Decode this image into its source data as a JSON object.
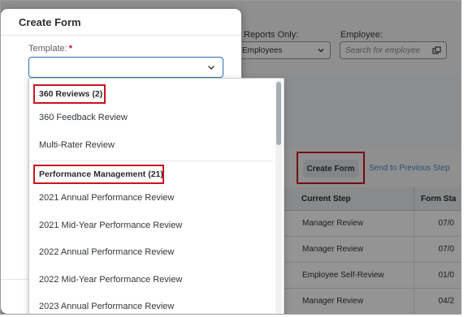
{
  "dialog": {
    "title": "Create Form",
    "template_label": "Template:",
    "required_marker": "*",
    "template_value": ""
  },
  "dropdown": {
    "groups": [
      {
        "label": "360 Reviews (2)",
        "items": [
          "360 Feedback Review",
          "Multi-Rater Review"
        ]
      },
      {
        "label": "Performance Management (21)",
        "items": [
          "2021 Annual Performance Review",
          "2021 Mid-Year Performance Review",
          "2022 Annual Performance Review",
          "2022 Mid-Year Performance Review",
          "2023 Annual Performance Review"
        ]
      }
    ]
  },
  "background": {
    "filters": {
      "reports_label": "Reports Only:",
      "reports_value": "Employees",
      "employee_label": "Employee:",
      "employee_placeholder": "Search for employee"
    },
    "toolbar": {
      "create_form": "Create Form",
      "send_previous": "Send to Previous Step"
    },
    "table": {
      "headers": [
        "Current Step",
        "Form Sta"
      ],
      "rows": [
        [
          "Manager Review",
          "07/0"
        ],
        [
          "Manager Review",
          "07/0"
        ],
        [
          "Employee Self-Review",
          "01/0"
        ],
        [
          "Manager Review",
          "04/2"
        ]
      ]
    }
  },
  "colors": {
    "highlight": "#c8141e",
    "accent": "#2b6cb0",
    "link": "#4a87c4"
  }
}
